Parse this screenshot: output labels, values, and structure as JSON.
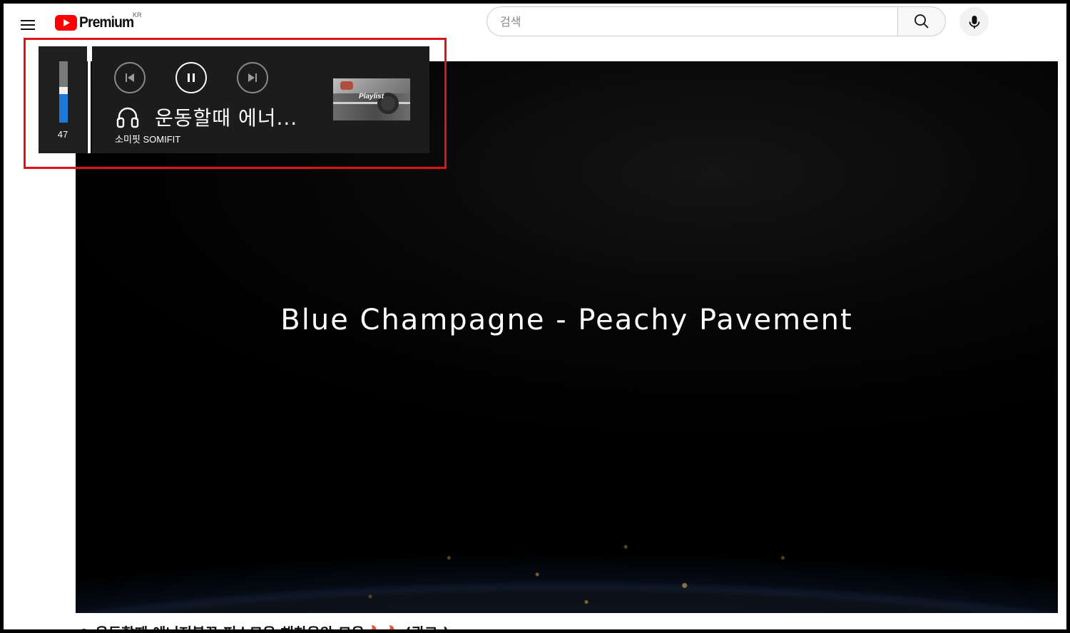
{
  "masthead": {
    "logo_text": "Premium",
    "region": "KR",
    "search_placeholder": "검색"
  },
  "video": {
    "overlay_title": "Blue Champagne - Peachy Pavement"
  },
  "media_flyout": {
    "volume": 47,
    "volume_label": "47",
    "track_title": "운동할때 에너...",
    "artist": "소미핏 SOMIFIT",
    "thumbnail_text": "Playlist",
    "state": "playing"
  },
  "below_title": "◎ 운동할때 에너지불끈 퍼스모음 해찬음악 모음🔥🔥 (광고 )",
  "colors": {
    "brand_red": "#ff0000",
    "volume_fill": "#1e78d7",
    "highlight_box": "#e0121a"
  },
  "icons": [
    "menu-icon",
    "youtube-logo-icon",
    "search-icon",
    "mic-icon",
    "previous-track-icon",
    "pause-icon",
    "next-track-icon",
    "headphones-icon"
  ]
}
